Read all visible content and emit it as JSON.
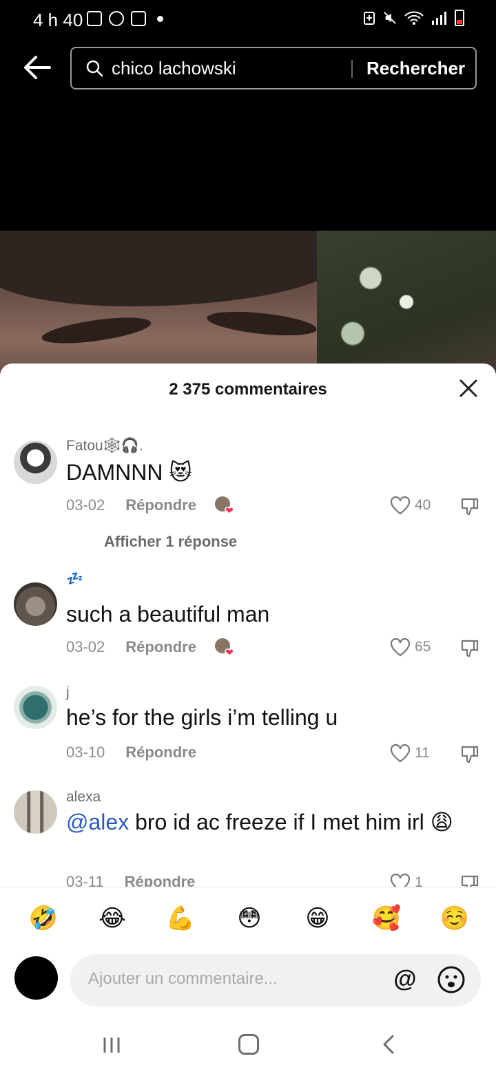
{
  "status_bar": {
    "time": "4 h 40"
  },
  "search": {
    "query": "chico lachowski",
    "submit_label": "Rechercher"
  },
  "comments_sheet": {
    "title": "2 375 commentaires",
    "comments": [
      {
        "username": "Fatou🕸️🎧.",
        "text": "DAMNNN 😻",
        "date": "03-02",
        "reply_label": "Répondre",
        "likes": "40",
        "creator_liked": true,
        "show_replies": "Afficher 1 réponse"
      },
      {
        "username": "💤",
        "text": "such a beautiful man",
        "date": "03-02",
        "reply_label": "Répondre",
        "likes": "65",
        "creator_liked": true
      },
      {
        "username": "j",
        "text": "he’s for the girls i’m telling u",
        "date": "03-10",
        "reply_label": "Répondre",
        "likes": "11",
        "creator_liked": false
      },
      {
        "username": "alexa",
        "mention": "@alex",
        "text": " bro id ac freeze if I met him irl 😩",
        "date": "03-11",
        "reply_label": "Répondre",
        "likes": "1",
        "creator_liked": false
      }
    ],
    "quick_emojis": [
      "🤣",
      "😂",
      "💪",
      "😳",
      "😁",
      "🥰",
      "☺️"
    ],
    "input_placeholder": "Ajouter un commentaire...",
    "at_label": "@"
  }
}
